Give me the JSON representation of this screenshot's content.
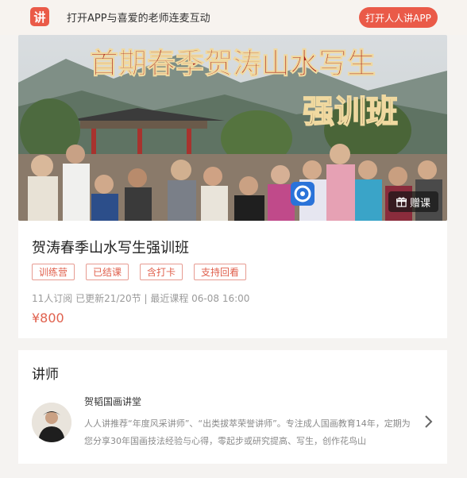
{
  "topbar": {
    "logo_text": "讲",
    "promo_text": "打开APP与喜爱的老师连麦互动",
    "open_button": "打开人人讲APP"
  },
  "banner": {
    "headline": "首期春季贺涛山水写生",
    "subheadline": "强训班",
    "gift_label": "赠课"
  },
  "course": {
    "title": "贺涛春季山水写生强训班",
    "tags": [
      "训练营",
      "已结课",
      "含打卡",
      "支持回看"
    ],
    "meta": "11人订阅  已更新21/20节 | 最近课程 06-08 16:00",
    "price": "¥800"
  },
  "teacher_section": {
    "title": "讲师",
    "name": "贺韬国画讲堂",
    "description": "人人讲推荐“年度风采讲师”、“出类拔萃荣誉讲师”。专注成人国画教育14年，定期为您分享30年国画技法经验与心得，零起步或研究提高、写生，创作花鸟山"
  },
  "colors": {
    "accent": "#ea5a48",
    "tag_border": "#e79b91",
    "muted_text": "#9a9a9a"
  },
  "icons": [
    "logo-icon",
    "gift-icon",
    "app-badge-icon",
    "chevron-right-icon"
  ]
}
